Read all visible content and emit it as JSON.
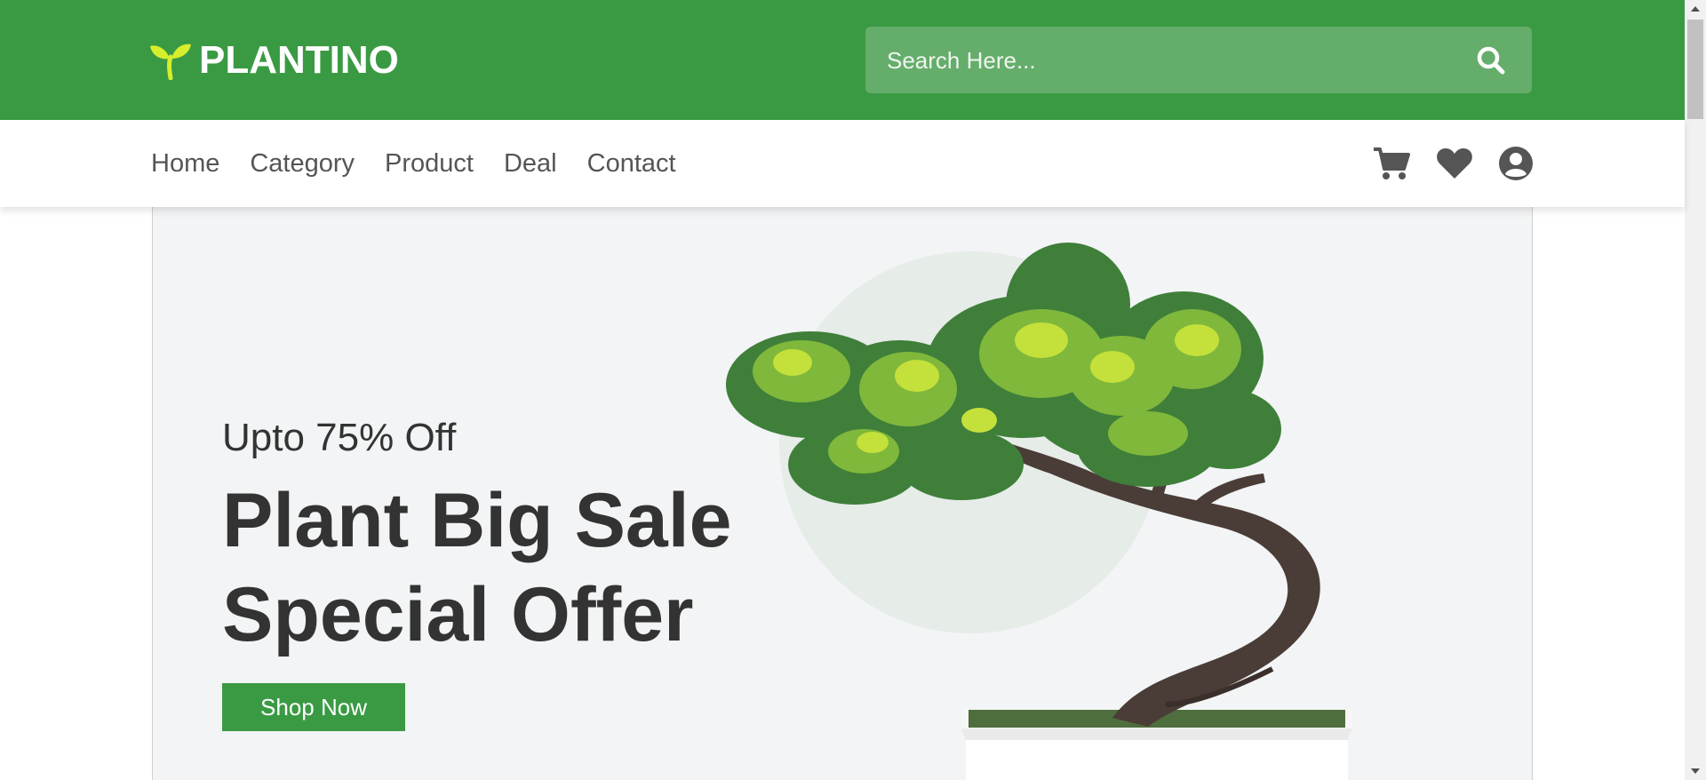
{
  "header": {
    "logo_text": "PLANTINO",
    "search_placeholder": "Search Here..."
  },
  "nav": {
    "links": [
      "Home",
      "Category",
      "Product",
      "Deal",
      "Contact"
    ],
    "icons": [
      "cart-icon",
      "heart-icon",
      "user-icon"
    ]
  },
  "hero": {
    "subtitle": "Upto 75% Off",
    "title_line1": "Plant Big Sale",
    "title_line2": "Special Offer",
    "cta": "Shop Now"
  },
  "colors": {
    "brand_green": "#3a9a43",
    "logo_accent": "#d6ee2c",
    "text_dark": "#333333"
  }
}
